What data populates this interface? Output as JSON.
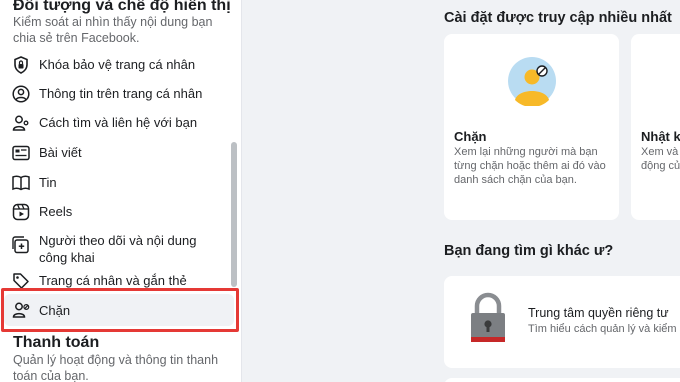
{
  "sidebar": {
    "section_title": "Đối tượng và chế độ hiển thị",
    "section_desc": "Kiểm soát ai nhìn thấy nội dung bạn chia sẻ trên Facebook.",
    "items": [
      {
        "label": "Khóa bảo vệ trang cá nhân",
        "icon": "shield-lock-icon"
      },
      {
        "label": "Thông tin trên trang cá nhân",
        "icon": "profile-circle-icon"
      },
      {
        "label": "Cách tìm và liên hệ với bạn",
        "icon": "user-search-icon"
      },
      {
        "label": "Bài viết",
        "icon": "post-icon"
      },
      {
        "label": "Tin",
        "icon": "book-icon"
      },
      {
        "label": "Reels",
        "icon": "reels-icon"
      },
      {
        "label": "Người theo dõi và nội dung công khai",
        "icon": "followers-icon"
      },
      {
        "label": "Trang cá nhân và gắn thẻ",
        "icon": "tag-icon"
      },
      {
        "label": "Chặn",
        "icon": "block-user-icon"
      }
    ],
    "payments_title": "Thanh toán",
    "payments_desc": "Quản lý hoạt động và thông tin thanh toán của bạn."
  },
  "main": {
    "most_visited_title": "Cài đặt được truy cập nhiều nhất",
    "cards": [
      {
        "title": "Chặn",
        "desc": "Xem lại những người mà bạn từng chặn hoặc thêm ai đó vào danh sách chặn của bạn.",
        "icon": "blocked-person-illustration"
      },
      {
        "title": "Nhật ký",
        "desc": "Xem và quản lý hoạt động của bạn",
        "icon": "activity-log-illustration"
      }
    ],
    "looking_for_title": "Bạn đang tìm gì khác ư?",
    "privacy_center": {
      "title": "Trung tâm quyền riêng tư",
      "desc": "Tìm hiểu cách quản lý và kiểm soát quyền riêng tư",
      "icon": "padlock-icon"
    }
  },
  "colors": {
    "highlight": "#e53935",
    "card_bg": "#ffffff",
    "page_bg": "#f0f2f5",
    "avatar_circle": "#b9dcf2",
    "avatar_accent": "#f7b928"
  }
}
